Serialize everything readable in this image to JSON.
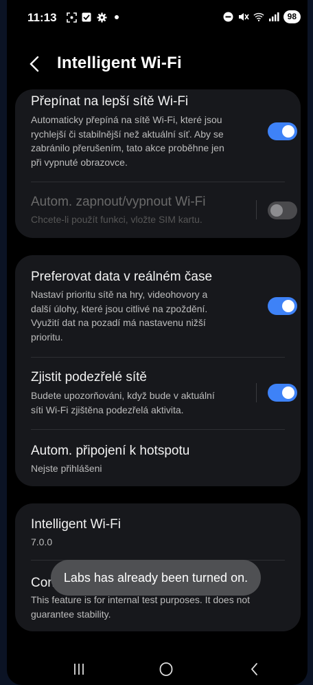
{
  "status_bar": {
    "time": "11:13",
    "battery": "98",
    "icons_left": [
      "screenshot-icon",
      "check-box-icon",
      "settings-gear-icon",
      "dot-icon"
    ],
    "icons_right": [
      "do-not-disturb-icon",
      "mute-icon",
      "wifi-icon",
      "signal-icon"
    ]
  },
  "header": {
    "title": "Intelligent Wi-Fi"
  },
  "card1": {
    "switch_better": {
      "title": "Přepínat na lepší sítě Wi-Fi",
      "line1": "Automaticky přepíná na sítě Wi-Fi, které jsou",
      "line2": "rychlejší či stabilnější než aktuální síť. Aby se",
      "line3": "zabránilo přerušením, tato akce proběhne jen",
      "line4": "při vypnuté obrazovce.",
      "enabled": true
    },
    "auto_wifi": {
      "title": "Autom. zapnout/vypnout Wi-Fi",
      "subtitle": "Chcete-li použít funkci, vložte SIM kartu.",
      "enabled": false
    }
  },
  "card2": {
    "realtime": {
      "title": "Preferovat data v reálném čase",
      "line1": "Nastaví prioritu sítě na hry, videohovory a",
      "line2": "další úlohy, které jsou citlivé na zpoždění.",
      "line3": "Využití dat na pozadí má nastavenu nižší",
      "line4": "prioritu.",
      "enabled": true
    },
    "suspicious": {
      "title": "Zjistit podezřelé sítě",
      "line1": "Budete upozorňováni, když bude v aktuální",
      "line2": "síti Wi-Fi zjištěna podezřelá aktivita.",
      "enabled": true
    },
    "hotspot": {
      "title": "Autom. připojení k hotspotu",
      "subtitle": "Nejste přihlášeni"
    }
  },
  "card3": {
    "version": {
      "title": "Intelligent Wi-Fi",
      "value": "7.0.0"
    },
    "labs": {
      "title_visible": "Con",
      "line1": "This feature is for internal test purposes. It does not",
      "line2": "guarantee stability."
    }
  },
  "toast": {
    "text": "Labs has already been turned on."
  },
  "navbar": {
    "buttons": [
      "recents",
      "home",
      "back"
    ]
  },
  "colors": {
    "accent": "#3e82f7",
    "background": "#000000",
    "card": "#17181c"
  }
}
